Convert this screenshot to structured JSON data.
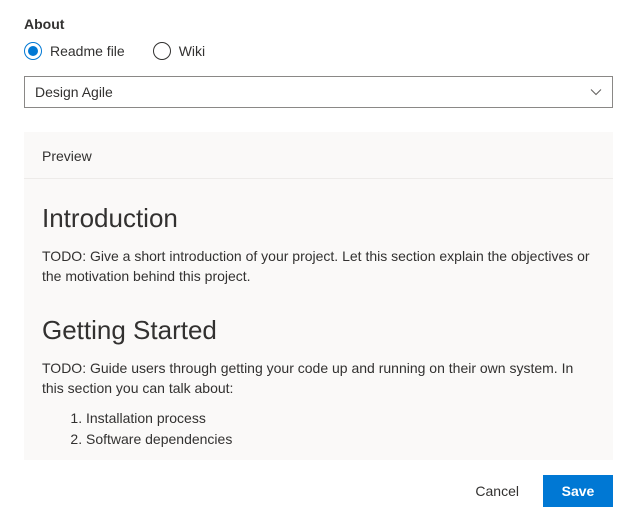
{
  "section_title": "About",
  "radio": {
    "readme_label": "Readme file",
    "wiki_label": "Wiki",
    "selected": "readme"
  },
  "dropdown": {
    "selected_value": "Design Agile"
  },
  "preview": {
    "tab_label": "Preview",
    "heading1": "Introduction",
    "paragraph1": "TODO: Give a short introduction of your project. Let this section explain the objectives or the motivation behind this project.",
    "heading2": "Getting Started",
    "paragraph2": "TODO: Guide users through getting your code up and running on their own system. In this section you can talk about:",
    "list_item1": "Installation process",
    "list_item2": "Software dependencies"
  },
  "buttons": {
    "cancel_label": "Cancel",
    "save_label": "Save"
  }
}
